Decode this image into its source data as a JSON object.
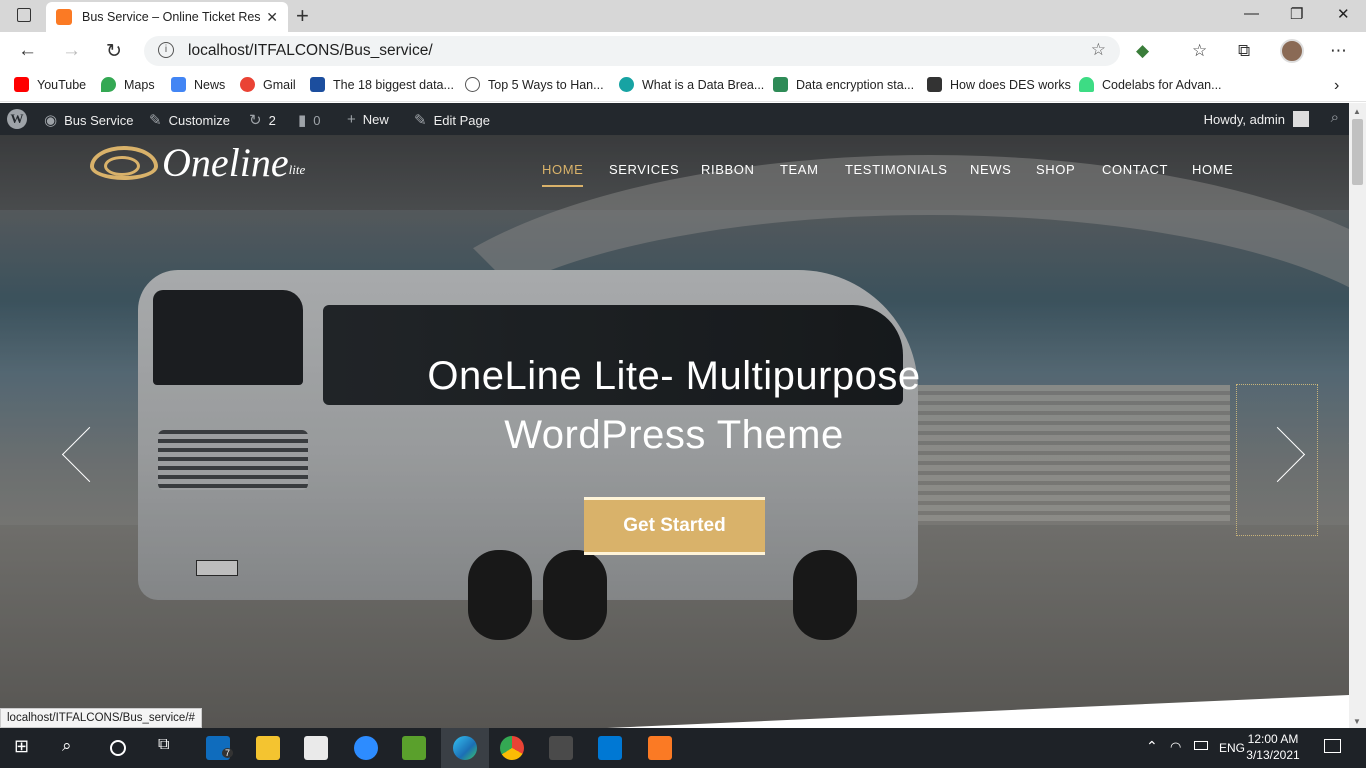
{
  "browser": {
    "tab_title": "Bus Service – Online Ticket Reser",
    "url": "localhost/ITFALCONS/Bus_service/",
    "status_url": "localhost/ITFALCONS/Bus_service/#",
    "bookmarks": [
      {
        "label": "YouTube",
        "color": "#ff0000"
      },
      {
        "label": "Maps",
        "color": "#34a853"
      },
      {
        "label": "News",
        "color": "#4285f4"
      },
      {
        "label": "Gmail",
        "color": "#ea4335"
      },
      {
        "label": "The 18 biggest data...",
        "color": "#1c4e9e"
      },
      {
        "label": "Top 5 Ways to Han...",
        "color": "#555555"
      },
      {
        "label": "What is a Data Brea...",
        "color": "#17a3a3"
      },
      {
        "label": "Data encryption sta...",
        "color": "#2e8b57"
      },
      {
        "label": "How does DES works",
        "color": "#333333"
      },
      {
        "label": "Codelabs for Advan...",
        "color": "#3ddc84"
      }
    ]
  },
  "wp_admin_bar": {
    "site_name": "Bus Service",
    "customize": "Customize",
    "updates_count": "2",
    "comments_count": "0",
    "new_label": "New",
    "edit_page": "Edit Page",
    "howdy": "Howdy, admin"
  },
  "site": {
    "logo_text": "Oneline",
    "logo_suffix": "lite",
    "nav": [
      "HOME",
      "SERVICES",
      "RIBBON",
      "TEAM",
      "TESTIMONIALS",
      "NEWS",
      "SHOP",
      "CONTACT",
      "HOME"
    ],
    "active_nav": "HOME"
  },
  "hero": {
    "title_line1": "OneLine Lite- Multipurpose",
    "title_line2": "WordPress Theme",
    "cta_label": "Get Started",
    "accent_color": "#d9b26a"
  },
  "taskbar": {
    "time": "12:00 AM",
    "date": "3/13/2021",
    "language": "ENG",
    "mail_badge": "7"
  }
}
